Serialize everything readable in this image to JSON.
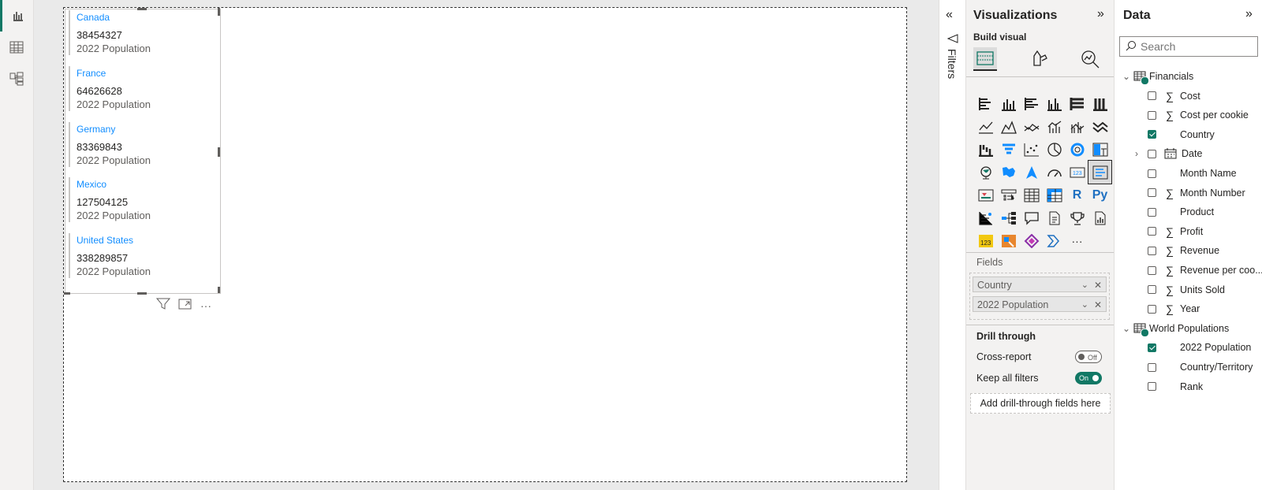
{
  "rail": {
    "icons": [
      "report-view-icon",
      "table-view-icon",
      "model-view-icon"
    ]
  },
  "card_visual": {
    "items": [
      {
        "category": "Canada",
        "value": "38454327",
        "label": "2022 Population"
      },
      {
        "category": "France",
        "value": "64626628",
        "label": "2022 Population"
      },
      {
        "category": "Germany",
        "value": "83369843",
        "label": "2022 Population"
      },
      {
        "category": "Mexico",
        "value": "127504125",
        "label": "2022 Population"
      },
      {
        "category": "United States",
        "value": "338289857",
        "label": "2022 Population"
      }
    ]
  },
  "filters": {
    "label": "Filters"
  },
  "visualizations": {
    "title": "Visualizations",
    "build_visual": "Build visual",
    "fields_label": "Fields",
    "wells": [
      "Country",
      "2022 Population"
    ],
    "drill_through": "Drill through",
    "cross_report": "Cross-report",
    "cross_report_state": "Off",
    "keep_all_filters": "Keep all filters",
    "keep_all_filters_state": "On",
    "add_drill": "Add drill-through fields here",
    "more_glyph": "···"
  },
  "data_pane": {
    "title": "Data",
    "search_placeholder": "Search",
    "tables": [
      {
        "name": "Financials",
        "fields": [
          {
            "name": "Cost",
            "sigma": true,
            "checked": false
          },
          {
            "name": "Cost per cookie",
            "sigma": true,
            "checked": false
          },
          {
            "name": "Country",
            "sigma": false,
            "checked": true
          },
          {
            "name": "Date",
            "sigma": false,
            "checked": false,
            "calendar": true
          },
          {
            "name": "Month Name",
            "sigma": false,
            "checked": false
          },
          {
            "name": "Month Number",
            "sigma": true,
            "checked": false
          },
          {
            "name": "Product",
            "sigma": false,
            "checked": false
          },
          {
            "name": "Profit",
            "sigma": true,
            "checked": false
          },
          {
            "name": "Revenue",
            "sigma": true,
            "checked": false
          },
          {
            "name": "Revenue per coo...",
            "sigma": true,
            "checked": false
          },
          {
            "name": "Units Sold",
            "sigma": true,
            "checked": false
          },
          {
            "name": "Year",
            "sigma": true,
            "checked": false
          }
        ]
      },
      {
        "name": "World Populations",
        "fields": [
          {
            "name": "2022 Population",
            "sigma": false,
            "checked": true
          },
          {
            "name": "Country/Territory",
            "sigma": false,
            "checked": false
          },
          {
            "name": "Rank",
            "sigma": false,
            "checked": false
          }
        ]
      }
    ]
  },
  "colors": {
    "accent": "#117865",
    "link": "#118dff"
  }
}
